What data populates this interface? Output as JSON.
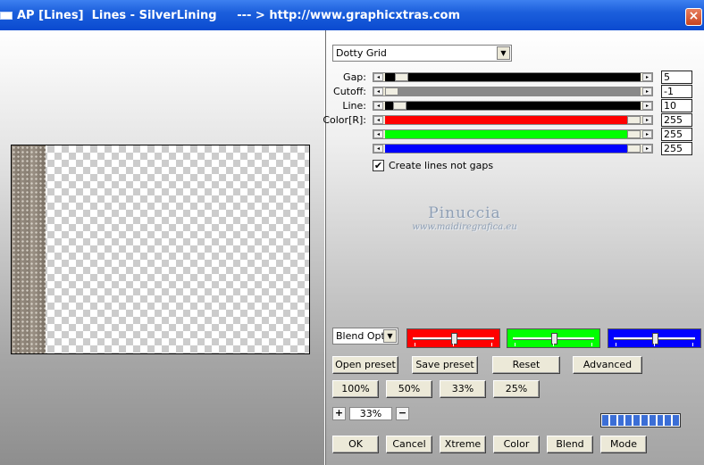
{
  "window": {
    "title": "AP [Lines]  Lines - SilverLining     --- > http://www.graphicxtras.com",
    "close_label": "×"
  },
  "preset": {
    "selected": "Dotty Grid"
  },
  "sliders": [
    {
      "label": "Gap:",
      "value": "5",
      "color": "#000000",
      "fill": 0.04
    },
    {
      "label": "Cutoff:",
      "value": "-1",
      "color": "#8a8a8a",
      "fill": 0.0
    },
    {
      "label": "Line:",
      "value": "10",
      "color": "#000000",
      "fill": 0.035
    },
    {
      "label": "Color[R]:",
      "value": "255",
      "color": "#ff0000",
      "fill": 1.0
    },
    {
      "label": "",
      "value": "255",
      "color": "#00ff00",
      "fill": 1.0
    },
    {
      "label": "",
      "value": "255",
      "color": "#0000ff",
      "fill": 1.0
    }
  ],
  "checkbox": {
    "label": "Create lines not gaps",
    "checked": true,
    "mark": "✔"
  },
  "watermark": {
    "line1": "Pinuccia",
    "line2": "www.maidiregrafica.eu"
  },
  "blend": {
    "selected": "Blend Options",
    "red": {
      "color": "#ff0000",
      "level": 0.5
    },
    "green": {
      "color": "#00ff00",
      "level": 0.5
    },
    "blue": {
      "color": "#0000ff",
      "level": 0.5
    }
  },
  "buttons": {
    "open_preset": "Open preset",
    "save_preset": "Save preset",
    "reset": "Reset",
    "advanced": "Advanced",
    "z100": "100%",
    "z50": "50%",
    "z33": "33%",
    "z25": "25%",
    "ok": "OK",
    "cancel": "Cancel",
    "xtreme": "Xtreme",
    "color": "Color",
    "blend": "Blend",
    "mode": "Mode"
  },
  "zoom": {
    "plus": "+",
    "value": "33%",
    "minus": "−"
  },
  "progress": {
    "segments": 10,
    "filled": 10
  }
}
